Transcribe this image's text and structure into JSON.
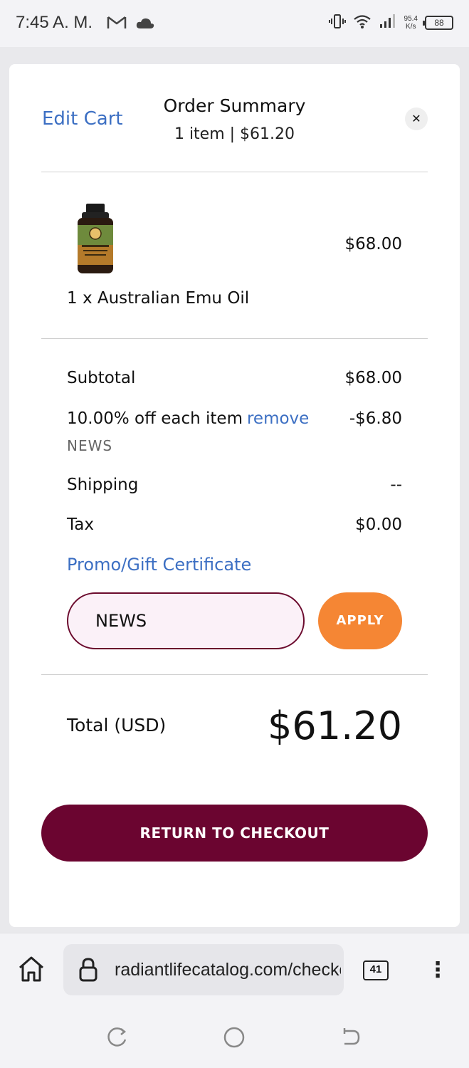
{
  "status_bar": {
    "time": "7:45 A. M.",
    "net_speed_value": "95.4",
    "net_speed_unit": "K/s",
    "battery": "88"
  },
  "cart": {
    "edit_label": "Edit Cart",
    "title": "Order Summary",
    "subtitle": "1 item | $61.20",
    "close_icon": "close-icon",
    "item": {
      "name": "1 x Australian Emu Oil",
      "price": "$68.00",
      "image": "emu-oil-bottle"
    },
    "subtotal_label": "Subtotal",
    "subtotal_value": "$68.00",
    "discount_label": "10.00% off each item",
    "remove_label": "remove",
    "discount_value": "-$6.80",
    "discount_code": "NEWS",
    "shipping_label": "Shipping",
    "shipping_value": "--",
    "tax_label": "Tax",
    "tax_value": "$0.00",
    "promo_label": "Promo/Gift Certificate",
    "promo_input_value": "NEWS",
    "apply_label": "APPLY",
    "total_label": "Total (USD)",
    "total_value": "$61.20",
    "return_label": "RETURN TO CHECKOUT"
  },
  "browser": {
    "url": "radiantlifecatalog.com/checkout",
    "tab_count": "41"
  },
  "colors": {
    "link_blue": "#3c6fc3",
    "apply_orange": "#f58634",
    "brand_maroon": "#6b0530",
    "input_bg": "#fbf1f8"
  }
}
